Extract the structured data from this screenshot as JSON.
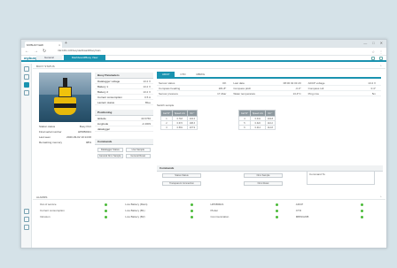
{
  "browser": {
    "tab_title": "MYBUOY/HW",
    "url": "192.168.1.100/buoy/dashboard#/buoy/main"
  },
  "app": {
    "logo": "mybuoy",
    "tabs": [
      "General",
      "Dashboard/Buoy View"
    ]
  },
  "section": {
    "title": "BUOY STATUS"
  },
  "buoy_info": [
    {
      "label": "Station status",
      "value": "Buoy Port"
    },
    {
      "label": "Final serial number",
      "value": "HPDB0021"
    },
    {
      "label": "Last seen",
      "value": "2020-03-02 10:14:00"
    },
    {
      "label": "Remaining memory",
      "value": "98%"
    }
  ],
  "buoy_params": {
    "title": "Buoy Parameters",
    "rows": [
      {
        "label": "Datalogger voltage",
        "value": "13.2 V"
      },
      {
        "label": "Battery 1",
        "value": "13.2 V"
      },
      {
        "label": "Battery 2",
        "value": "13.2 V"
      },
      {
        "label": "Current consumption",
        "value": "0.5 A"
      },
      {
        "label": "Lantern status",
        "value": "Blue"
      }
    ]
  },
  "positioning": {
    "title": "Positioning",
    "rows": [
      {
        "label": "latitude",
        "value": "43.6766"
      },
      {
        "label": "longitude",
        "value": "-3.4009"
      },
      {
        "label": "datalogger",
        "value": ""
      }
    ]
  },
  "commands_left": {
    "title": "Commands",
    "buttons": [
      "Datalogger Status",
      "Live Sample",
      "General Nmx Sample",
      "General Reset"
    ]
  },
  "sensor_tabs": [
    "ADCP",
    "CTD",
    "MBWG"
  ],
  "sensor_grid": [
    {
      "l1": "Sensor status",
      "v1": "OK",
      "l2": "Last data",
      "v2": "08:00 02 03 20",
      "l3": "ADCP voltage",
      "v3": "13.2 V"
    },
    {
      "l1": "Compass heading",
      "v1": "181.8°",
      "l2": "Compass pitch",
      "v2": "-0.3°",
      "l3": "Compass roll",
      "v3": "0.4°"
    },
    {
      "l1": "Sensor pressure",
      "v1": "17 dbar",
      "l2": "Water temperature",
      "v2": "13.4°C",
      "l3": "Ping nice",
      "v3": "5m"
    }
  ],
  "switch_label": "Switch sample",
  "table1": {
    "headers": [
      "Cell N°",
      "Speed m/s",
      "Dir °"
    ],
    "rows": [
      [
        "1",
        "0.718",
        "104.4"
      ],
      [
        "2",
        "0.672",
        "108.3"
      ],
      [
        "3",
        "0.591",
        "107.9"
      ]
    ]
  },
  "table2": {
    "headers": [
      "Cell N°",
      "Speed m/s",
      "Dir °"
    ],
    "rows": [
      [
        "4",
        "0.441",
        "104.8"
      ],
      [
        "5",
        "0.322",
        "110.2"
      ],
      [
        "6",
        "0.214",
        "112.8"
      ]
    ]
  },
  "cmd_right": {
    "title": "Commands",
    "buttons": [
      "Status Status",
      "Nmx Sample",
      "Transparent Connection",
      "Nmx Reset"
    ],
    "send_to": "Command To"
  },
  "alarms": {
    "title": "ALARMS",
    "items": [
      {
        "label": "Out of service",
        "color": "#4cbb3a"
      },
      {
        "label": "Low Battery (Main)",
        "color": "#4cbb3a"
      },
      {
        "label": "HPDB0021",
        "color": "#4cbb3a"
      },
      {
        "label": "ADCP",
        "color": "#4cbb3a"
      },
      {
        "label": "Current consumption",
        "color": "#4cbb3a"
      },
      {
        "label": "Low Battery (B1)",
        "color": "#4cbb3a"
      },
      {
        "label": "Plotter",
        "color": "#4cbb3a"
      },
      {
        "label": "CTD",
        "color": "#4cbb3a"
      },
      {
        "label": "Intrusion",
        "color": "#4cbb3a"
      },
      {
        "label": "Low Battery (B2)",
        "color": "#4cbb3a"
      },
      {
        "label": "Communication",
        "color": "#4cbb3a"
      },
      {
        "label": "MBWG/DB",
        "color": "#4cbb3a"
      }
    ]
  },
  "colors": {
    "accent": "#1a93b0",
    "ok": "#4cbb3a",
    "page_bg": "#d5e2e8"
  }
}
